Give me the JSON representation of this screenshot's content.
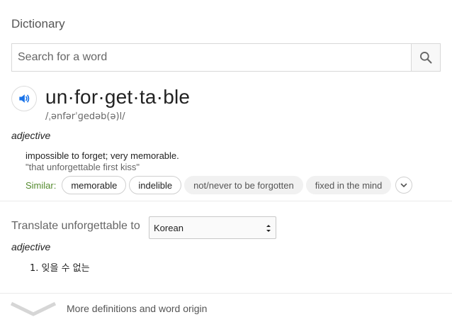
{
  "header": {
    "title": "Dictionary"
  },
  "search": {
    "placeholder": "Search for a word",
    "value": ""
  },
  "entry": {
    "word": "un·for·get·ta·ble",
    "phonetic": "/ˌənfərˈɡedəb(ə)l/",
    "part_of_speech": "adjective",
    "definition": "impossible to forget; very memorable.",
    "example": "\"that unforgettable first kiss\"",
    "similar_label": "Similar:",
    "similar": [
      "memorable",
      "indelible",
      "not/never to be forgotten",
      "fixed in the mind"
    ]
  },
  "translate": {
    "label": "Translate unforgettable to",
    "selected_language": "Korean",
    "part_of_speech": "adjective",
    "results": [
      "1. 잊을 수 없는"
    ]
  },
  "footer": {
    "more_label": "More definitions and word origin"
  },
  "colors": {
    "accent_blue": "#1a73e8",
    "similar_green": "#558b2f"
  },
  "icons": [
    "search-icon",
    "speaker-icon",
    "chevron-down-icon",
    "select-arrows-icon"
  ]
}
